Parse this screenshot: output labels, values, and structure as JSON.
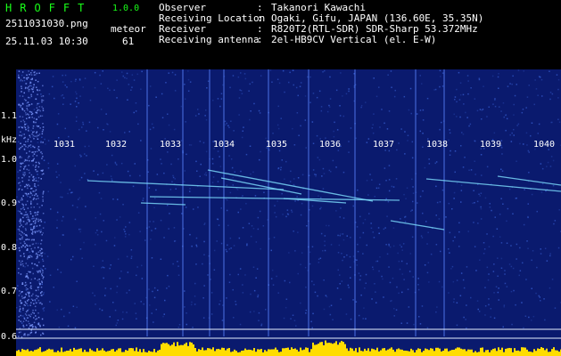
{
  "header": {
    "app_title": "HROFFT",
    "app_version": "1.0.0",
    "file_name": "2511031030.png",
    "datetime": "25.11.03 10:30",
    "meteor_label": "meteor",
    "meteor_count": "61",
    "info": [
      {
        "label": "Observer",
        "sep": ":",
        "value": "Takanori Kawachi"
      },
      {
        "label": "Receiving Location",
        "sep": ":",
        "value": "Ogaki, Gifu, JAPAN (136.60E, 35.35N)"
      },
      {
        "label": "Receiver",
        "sep": ":",
        "value": "R820T2(RTL-SDR) SDR-Sharp 53.372MHz"
      },
      {
        "label": "Receiving antenna",
        "sep": ":",
        "value": "2el-HB9CV Vertical (el. E-W)"
      }
    ]
  },
  "spectrogram": {
    "y_unit": "kHz",
    "y_ticks": [
      "1.1",
      "1.0",
      "0.9",
      "0.8",
      "0.7",
      "0.6"
    ],
    "x_ticks": [
      "1031",
      "1032",
      "1033",
      "1034",
      "1035",
      "1036",
      "1037",
      "1038",
      "1039",
      "1040"
    ],
    "colors": {
      "background": "#0a1a6e",
      "noise": "#3a63d8",
      "signal": "#7fe0ff",
      "grid": "#e6f0ff",
      "baseline": "#ffdd00"
    }
  }
}
